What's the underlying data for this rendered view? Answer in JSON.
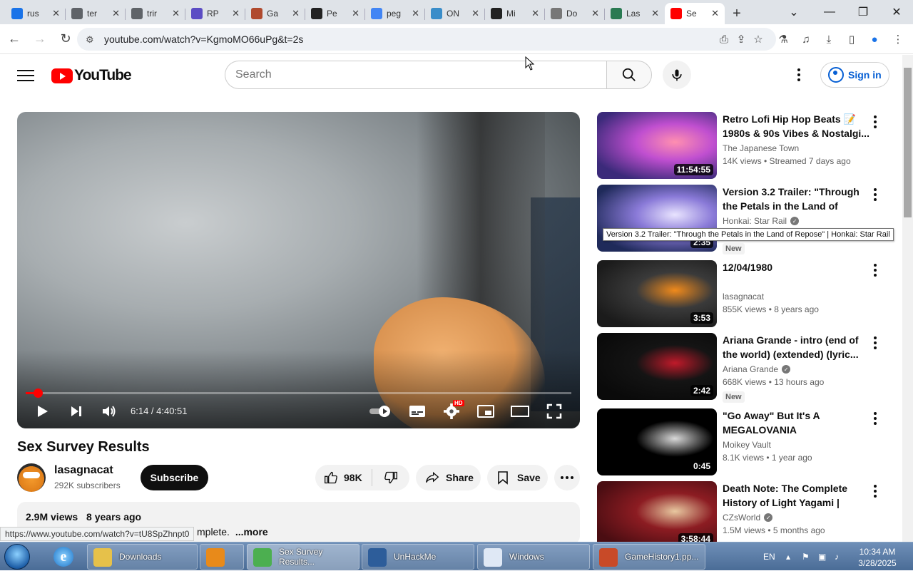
{
  "browser": {
    "tabs": [
      {
        "title": "rus",
        "color": "#1a73e8"
      },
      {
        "title": "ter",
        "color": "#5f6368"
      },
      {
        "title": "trir",
        "color": "#5f6368"
      },
      {
        "title": "RP",
        "color": "#5b4cc4"
      },
      {
        "title": "Ga",
        "color": "#b04a2e"
      },
      {
        "title": "Pe",
        "color": "#222222"
      },
      {
        "title": "peg",
        "color": "#4285f4"
      },
      {
        "title": "ON",
        "color": "#3a8dc9"
      },
      {
        "title": "Mi",
        "color": "#222222"
      },
      {
        "title": "Do",
        "color": "#777777"
      },
      {
        "title": "Las",
        "color": "#2a7a52"
      },
      {
        "title": "Se",
        "color": "#ff0000"
      }
    ],
    "url": "youtube.com/watch?v=KgmoMO66uPg&t=2s"
  },
  "youtube": {
    "logo_text": "YouTube",
    "search_placeholder": "Search",
    "sign_in": "Sign in"
  },
  "player": {
    "time": "6:14 / 4:40:51",
    "progress_fraction": 0.022,
    "hd_badge": "HD"
  },
  "video": {
    "title": "Sex Survey Results",
    "channel": "lasagnacat",
    "subscribers": "292K subscribers",
    "subscribe_label": "Subscribe",
    "likes": "98K",
    "share_label": "Share",
    "save_label": "Save",
    "views": "2.9M views",
    "age": "8 years ago",
    "description_snippet": "mplete.",
    "more_label": "...more"
  },
  "status_url": "https://www.youtube.com/watch?v=tU8SpZhnpt0",
  "recommendations": [
    {
      "title": "Retro Lofi Hip Hop Beats 📝 1980s & 90s Vibes & Nostalgi...",
      "channel": "The Japanese Town",
      "verified": false,
      "meta": "14K views  •  Streamed 7 days ago",
      "duration": "11:54:55",
      "badge": "",
      "thumb": [
        "#3b2a7a",
        "#c04fd0",
        "#ff8fb0"
      ]
    },
    {
      "title": "Version 3.2 Trailer: \"Through the Petals in the Land of Repose\" |...",
      "channel": "Honkai: Star Rail",
      "verified": true,
      "meta": "",
      "duration": "2:35",
      "badge": "New",
      "thumb": [
        "#1f2a5a",
        "#8a7ad8",
        "#e9e4ff"
      ]
    },
    {
      "title": "12/04/1980",
      "channel": "lasagnacat",
      "verified": false,
      "meta": "855K views  •  8 years ago",
      "duration": "3:53",
      "badge": "",
      "thumb": [
        "#1b1b1b",
        "#3a3a3a",
        "#f08a1c"
      ]
    },
    {
      "title": "Ariana Grande - intro (end of the world) (extended) (lyric...",
      "channel": "Ariana Grande",
      "verified": true,
      "meta": "668K views  •  13 hours ago",
      "duration": "2:42",
      "badge": "New",
      "thumb": [
        "#0a0a0a",
        "#141414",
        "#c01a2a"
      ]
    },
    {
      "title": "\"Go Away\" But It's A MEGALOVANIA",
      "channel": "Moikey Vault",
      "verified": false,
      "meta": "8.1K views  •  1 year ago",
      "duration": "0:45",
      "badge": "",
      "thumb": [
        "#000000",
        "#000000",
        "#d9d9d9"
      ]
    },
    {
      "title": "Death Note: The Complete History of Light Yagami | Horr...",
      "channel": "CZsWorld",
      "verified": true,
      "meta": "1.5M views  •  5 months ago",
      "duration": "3:58:44",
      "badge": "",
      "thumb": [
        "#4a0d12",
        "#8c1c22",
        "#e8c8a0"
      ]
    }
  ],
  "tooltip": "Version 3.2 Trailer: \"Through the Petals in the Land of Repose\" | Honkai: Star Rail",
  "taskbar": {
    "items": [
      {
        "label": "Downloads",
        "color": "#e6c14a",
        "active": false
      },
      {
        "label": "",
        "color": "#e88a1a",
        "active": false
      },
      {
        "label": "Sex Survey Results...",
        "color": "#4caf50",
        "active": true
      },
      {
        "label": "UnHackMe",
        "color": "#2d5d9a",
        "active": false
      },
      {
        "label": "Windows",
        "color": "#dfe8f5",
        "active": false
      },
      {
        "label": "GameHistory1.pp...",
        "color": "#c84a28",
        "active": false
      }
    ],
    "lang": "EN",
    "time": "10:34 AM",
    "date": "3/28/2025"
  }
}
